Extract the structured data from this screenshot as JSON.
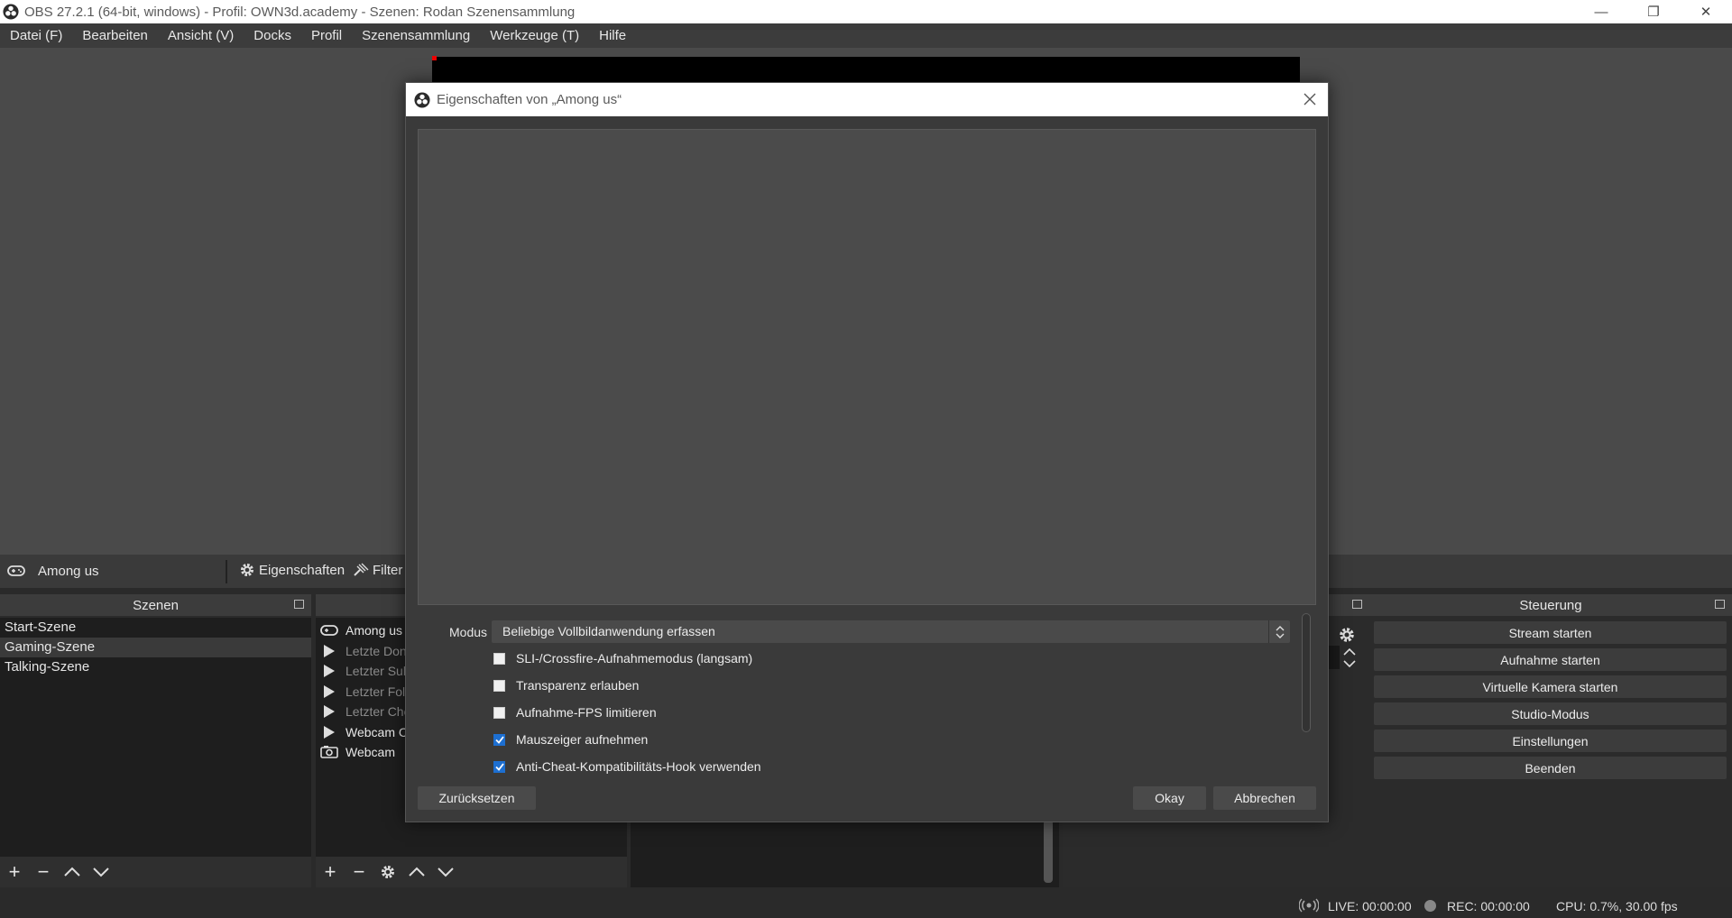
{
  "window": {
    "title": "OBS 27.2.1 (64-bit, windows) - Profil: OWN3d.academy - Szenen: Rodan Szenensammlung",
    "minimize": "—",
    "restore": "❐",
    "close": "✕"
  },
  "menu": [
    "Datei (F)",
    "Bearbeiten",
    "Ansicht (V)",
    "Docks",
    "Profil",
    "Szenensammlung",
    "Werkzeuge (T)",
    "Hilfe"
  ],
  "source_toolbar": {
    "selected_source": "Among us",
    "properties_label": "Eigenschaften",
    "filter_label": "Filter"
  },
  "scenes_dock": {
    "title": "Szenen",
    "items": [
      "Start-Szene",
      "Gaming-Szene",
      "Talking-Szene"
    ],
    "selected_index": 1
  },
  "sources_dock": {
    "items": [
      {
        "label": "Among us",
        "icon": "gamepad-icon",
        "dim": false
      },
      {
        "label": "Letzte Don",
        "icon": "play-icon",
        "dim": true
      },
      {
        "label": "Letzter Sul",
        "icon": "play-icon",
        "dim": true
      },
      {
        "label": "Letzter Fol",
        "icon": "play-icon",
        "dim": true
      },
      {
        "label": "Letzter Che",
        "icon": "play-icon",
        "dim": true
      },
      {
        "label": "Webcam C",
        "icon": "play-icon",
        "dim": false
      },
      {
        "label": "Webcam",
        "icon": "camera-icon",
        "dim": false
      }
    ]
  },
  "controls_dock": {
    "title": "Steuerung",
    "buttons": [
      "Stream starten",
      "Aufnahme starten",
      "Virtuelle Kamera starten",
      "Studio-Modus",
      "Einstellungen",
      "Beenden"
    ]
  },
  "status": {
    "live": "LIVE: 00:00:00",
    "rec": "REC: 00:00:00",
    "cpu": "CPU: 0.7%, 30.00 fps"
  },
  "dialog": {
    "title": "Eigenschaften von „Among us“",
    "mode_label": "Modus",
    "mode_value": "Beliebige Vollbildanwendung erfassen",
    "checkboxes": [
      {
        "label": "SLI-/Crossfire-Aufnahmemodus (langsam)",
        "checked": false
      },
      {
        "label": "Transparenz erlauben",
        "checked": false
      },
      {
        "label": "Aufnahme-FPS limitieren",
        "checked": false
      },
      {
        "label": "Mauszeiger aufnehmen",
        "checked": true
      },
      {
        "label": "Anti-Cheat-Kompatibilitäts-Hook verwenden",
        "checked": true
      }
    ],
    "reset_label": "Zurücksetzen",
    "ok_label": "Okay",
    "cancel_label": "Abbrechen"
  },
  "colors": {
    "background": "#2a2a2a",
    "accent_checkbox": "#1d6fd1",
    "preview": "#4a4a4a"
  }
}
